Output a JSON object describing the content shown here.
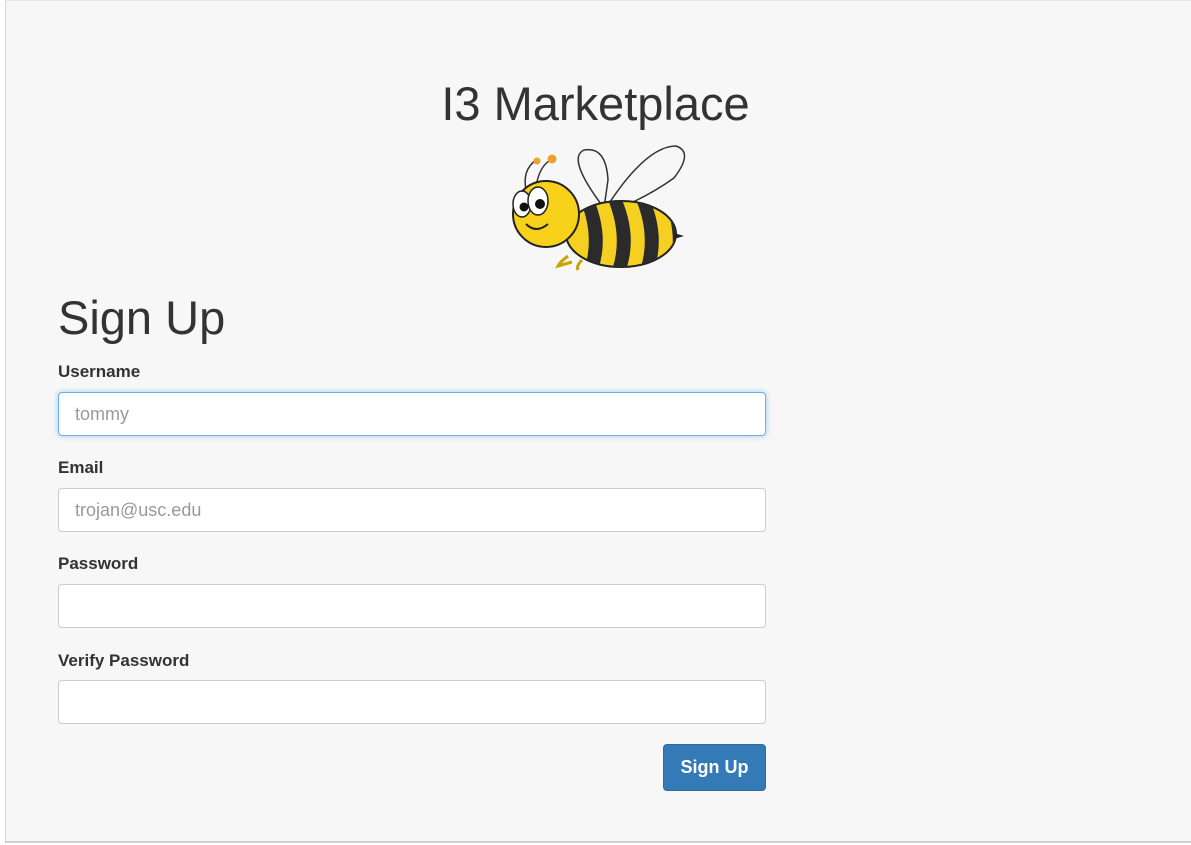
{
  "site_title": "I3 Marketplace",
  "logo": {
    "icon": "bee-mascot-icon"
  },
  "page_title": "Sign Up",
  "form": {
    "username_label": "Username",
    "username_placeholder": "tommy",
    "email_label": "Email",
    "email_placeholder": "trojan@usc.edu",
    "password_label": "Password",
    "verify_password_label": "Verify Password",
    "submit_label": "Sign Up"
  },
  "colors": {
    "primary_button": "#337ab7",
    "focus_border": "#66afe9",
    "page_background": "#f7f7f7"
  }
}
